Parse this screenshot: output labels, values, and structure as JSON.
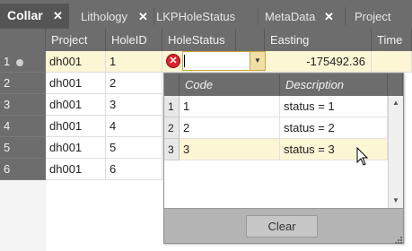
{
  "tabs": [
    {
      "label": "Collar",
      "active": true,
      "closable": true
    },
    {
      "label": "Lithology",
      "active": false,
      "closable": true
    },
    {
      "label": "LKPHoleStatus",
      "active": false,
      "closable": false
    },
    {
      "label": "MetaData",
      "active": false,
      "closable": true
    },
    {
      "label": "Project",
      "active": false,
      "closable": false
    }
  ],
  "close_glyph": "✕",
  "grid": {
    "columns": [
      "Project",
      "HoleID",
      "HoleStatus",
      "Easting",
      "Time"
    ],
    "rows": [
      {
        "num": "1",
        "project": "dh001",
        "holeid": "1",
        "easting": "-175492.36"
      },
      {
        "num": "2",
        "project": "dh001",
        "holeid": "2",
        "easting": ""
      },
      {
        "num": "3",
        "project": "dh001",
        "holeid": "3",
        "easting": ""
      },
      {
        "num": "4",
        "project": "dh001",
        "holeid": "4",
        "easting": ""
      },
      {
        "num": "5",
        "project": "dh001",
        "holeid": "5",
        "easting": ""
      },
      {
        "num": "6",
        "project": "dh001",
        "holeid": "6",
        "easting": ""
      }
    ]
  },
  "editor": {
    "error_glyph": "✕",
    "dropdown_glyph": "▼"
  },
  "dropdown": {
    "columns": [
      "Code",
      "Description"
    ],
    "rows": [
      {
        "num": "1",
        "code": "1",
        "description": "status = 1"
      },
      {
        "num": "2",
        "code": "2",
        "description": "status = 2"
      },
      {
        "num": "3",
        "code": "3",
        "description": "status = 3"
      }
    ],
    "clear_label": "Clear",
    "scroll_up_glyph": "▲",
    "scroll_down_glyph": "▼"
  },
  "colors": {
    "header_bg": "#6d6d6d",
    "selected_row": "#fdf6d4",
    "error_red": "#d9262c",
    "accent_gold": "#c9a641"
  }
}
